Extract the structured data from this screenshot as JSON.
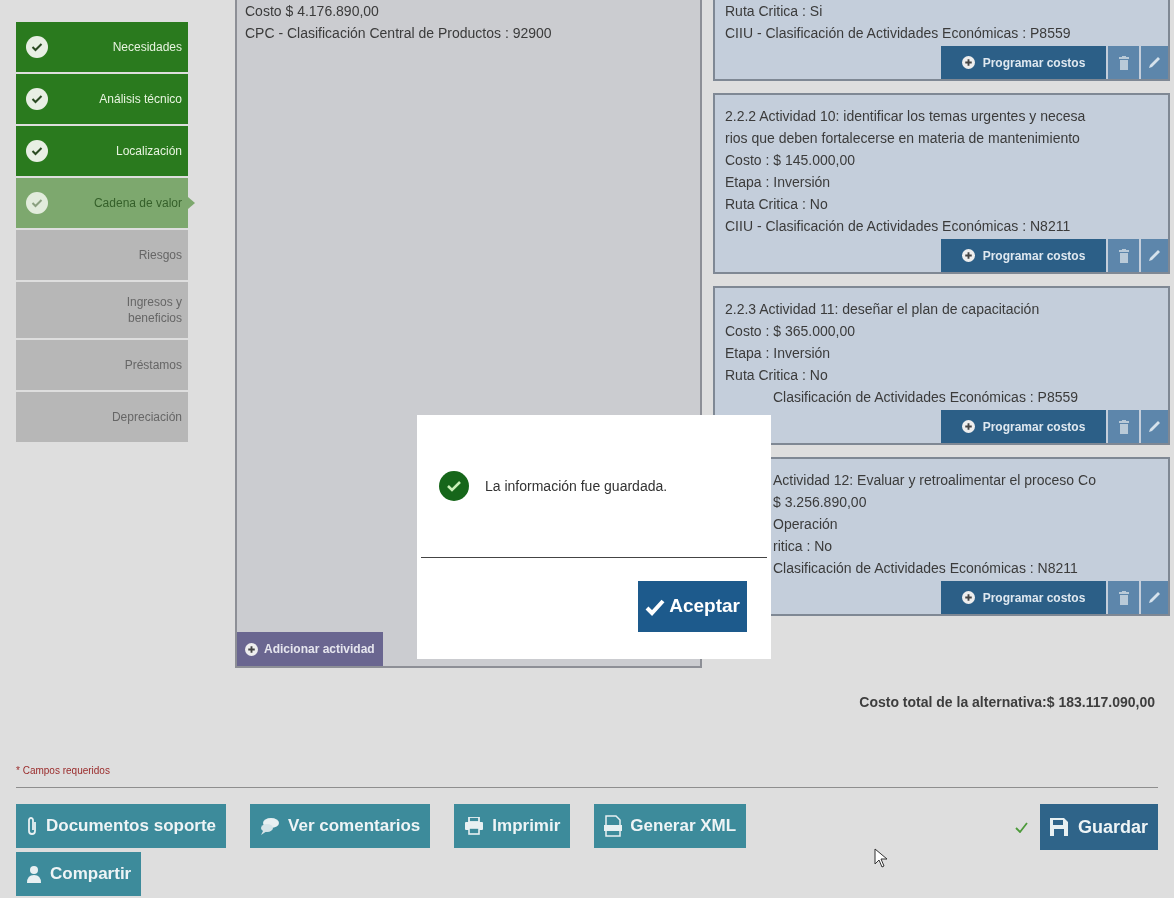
{
  "sidebar": {
    "steps": [
      {
        "label": "Necesidades",
        "completed": true,
        "selected": false
      },
      {
        "label": "Análisis técnico",
        "completed": true,
        "selected": false
      },
      {
        "label": "Localización",
        "completed": true,
        "selected": false
      },
      {
        "label": "Cadena de valor",
        "completed": true,
        "selected": true
      },
      {
        "label": "Riesgos",
        "completed": false,
        "selected": false
      },
      {
        "label": "Ingresos y beneficios",
        "completed": false,
        "selected": false
      },
      {
        "label": "Préstamos",
        "completed": false,
        "selected": false
      },
      {
        "label": "Depreciación",
        "completed": false,
        "selected": false
      }
    ]
  },
  "alternative_panel": {
    "lines": [
      "Costo $ 4.176.890,00",
      "CPC - Clasificación Central de Productos : 92900"
    ],
    "add_button": "Adicionar actividad"
  },
  "activities": [
    {
      "lines": [
        {
          "text": "Ruta Critica : Si",
          "kind": "full"
        },
        {
          "text": "CIIU - Clasificación de Actividades Económicas : P8559",
          "kind": "full"
        }
      ],
      "schedule_button": "Programar costos"
    },
    {
      "lines": [
        {
          "text": "2.2.2 Actividad 10: identificar los temas urgentes y necesa",
          "kind": "full"
        },
        {
          "text": "rios que deben fortalecerse en materia de mantenimiento",
          "kind": "full"
        },
        {
          "text": "Costo : $ 145.000,00",
          "kind": "full"
        },
        {
          "text": "Etapa : Inversión",
          "kind": "full"
        },
        {
          "text": "Ruta Critica : No",
          "kind": "full"
        },
        {
          "text": "CIIU - Clasificación de Actividades Económicas : N8211",
          "kind": "full"
        }
      ],
      "schedule_button": "Programar costos"
    },
    {
      "lines": [
        {
          "text": "2.2.3 Actividad 11: deseñar el plan de capacitación",
          "kind": "full"
        },
        {
          "text": "Costo : $ 365.000,00",
          "kind": "full"
        },
        {
          "text": "Etapa : Inversión",
          "kind": "full"
        },
        {
          "text": "Ruta Critica : No",
          "kind": "full"
        },
        {
          "text": "Clasificación de Actividades Económicas : P8559",
          "kind": "clipped"
        }
      ],
      "schedule_button": "Programar costos"
    },
    {
      "lines": [
        {
          "text": "Actividad 12: Evaluar y retroalimentar el proceso Co",
          "kind": "clipped"
        },
        {
          "text": "$ 3.256.890,00",
          "kind": "clipped"
        },
        {
          "text": "Operación",
          "kind": "clipped"
        },
        {
          "text": "ritica : No",
          "kind": "clipped"
        },
        {
          "text": "Clasificación de Actividades Económicas : N8211",
          "kind": "clipped"
        }
      ],
      "schedule_button": "Programar costos"
    }
  ],
  "total": "Costo total de la alternativa:$ 183.117.090,00",
  "required_note": "* Campos requeridos",
  "actions": [
    {
      "label": "Documentos soporte"
    },
    {
      "label": "Ver comentarios"
    },
    {
      "label": "Imprimir"
    },
    {
      "label": "Generar XML"
    },
    {
      "label": "Compartir"
    }
  ],
  "save": {
    "label": "Guardar",
    "saved": true
  },
  "dialog": {
    "message": "La información fue guardada.",
    "button": "Aceptar"
  }
}
